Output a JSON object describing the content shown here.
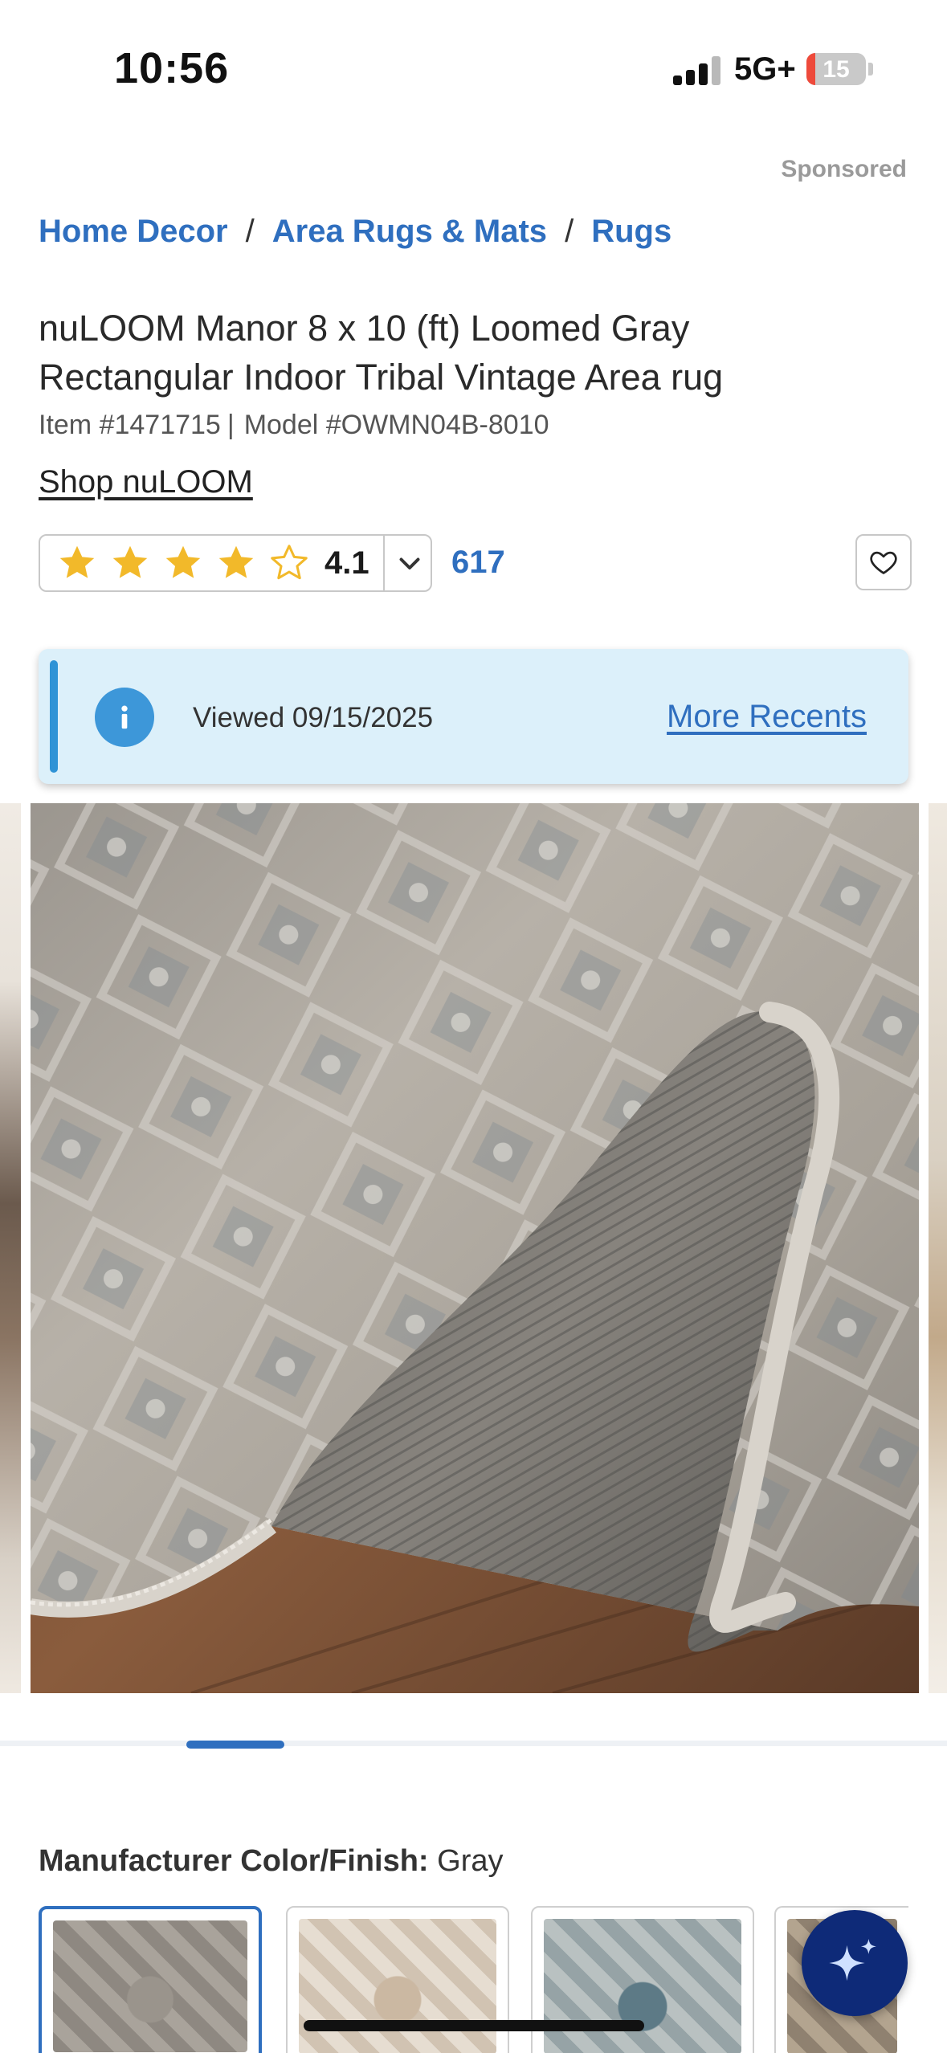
{
  "status_bar": {
    "time": "10:56",
    "network": "5G+",
    "battery": "15",
    "battery_level_percent": 15
  },
  "sponsored_label": "Sponsored",
  "breadcrumb": {
    "items": [
      "Home Decor",
      "Area Rugs & Mats",
      "Rugs"
    ],
    "separator": "/"
  },
  "product": {
    "title": "nuLOOM Manor 8 x 10 (ft) Loomed Gray Rectangular Indoor Tribal Vintage Area rug",
    "item_number": "Item #1471715",
    "model_number": "Model #OWMN04B-8010",
    "meta_separator": "|",
    "shop_link": "Shop nuLOOM"
  },
  "rating": {
    "value": "4.1",
    "stars_filled": 4,
    "stars_total": 5,
    "review_count": "617"
  },
  "viewed_banner": {
    "text": "Viewed 09/15/2025",
    "link": "More Recents",
    "icon": "info-icon"
  },
  "gallery": {
    "image_alt": "rug-image",
    "position_fraction": 0.2
  },
  "color_finish": {
    "label": "Manufacturer Color/Finish:",
    "value": "Gray",
    "swatch_count_visible": 4
  },
  "colors": {
    "accent": "#2f6fbf",
    "star": "#f2b92a",
    "banner_bg": "#dcf0fa",
    "ai_button": "#0e2a78"
  }
}
